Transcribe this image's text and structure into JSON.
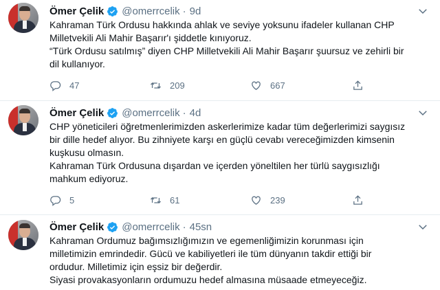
{
  "tweets": [
    {
      "name": "Ömer Çelik",
      "handle": "@omerrcelik",
      "separator": "·",
      "time": "9d",
      "lines": [
        "Kahraman Türk Ordusu hakkında ahlak ve seviye yoksunu ifadeler kullanan CHP",
        "Milletvekili Ali Mahir Başarır'ı şiddetle kınıyoruz.",
        "“Türk Ordusu satılmış” diyen CHP Milletvekili Ali Mahir Başarır şuursuz ve zehirli bir",
        "dil kullanıyor."
      ],
      "replies": "47",
      "retweets": "209",
      "likes": "667"
    },
    {
      "name": "Ömer Çelik",
      "handle": "@omerrcelik",
      "separator": "·",
      "time": "4d",
      "lines": [
        "CHP yöneticileri öğretmenlerimizden askerlerimize kadar tüm değerlerimizi saygısız",
        "bir dille hedef alıyor. Bu zihniyete karşı en güçlü cevabı vereceğimizden kimsenin",
        "kuşkusu olmasın.",
        "Kahraman Türk Ordusuna dışardan ve içerden yöneltilen her türlü saygısızlığı",
        "mahkum ediyoruz."
      ],
      "replies": "5",
      "retweets": "61",
      "likes": "239"
    },
    {
      "name": "Ömer Çelik",
      "handle": "@omerrcelik",
      "separator": "·",
      "time": "45sn",
      "lines": [
        "Kahraman Ordumuz bağımsızlığımızın ve egemenliğimizin korunması için",
        "milletimizin emrindedir. Gücü ve kabiliyetleri ile tüm dünyanın takdir ettiği bir",
        "ordudur. Milletimiz için eşsiz bir değerdir.",
        "Siyasi provakasyonların ordumuzu hedef almasına müsaade etmeyeceğiz."
      ]
    }
  ],
  "icons": {
    "verified": "verified-badge-icon",
    "caret": "chevron-down-icon",
    "reply": "reply-icon",
    "retweet": "retweet-icon",
    "like": "heart-icon",
    "share": "share-icon"
  },
  "colors": {
    "verified": "#1da1f2",
    "secondary_text": "#5b7083",
    "divider": "#e6ecf0"
  }
}
